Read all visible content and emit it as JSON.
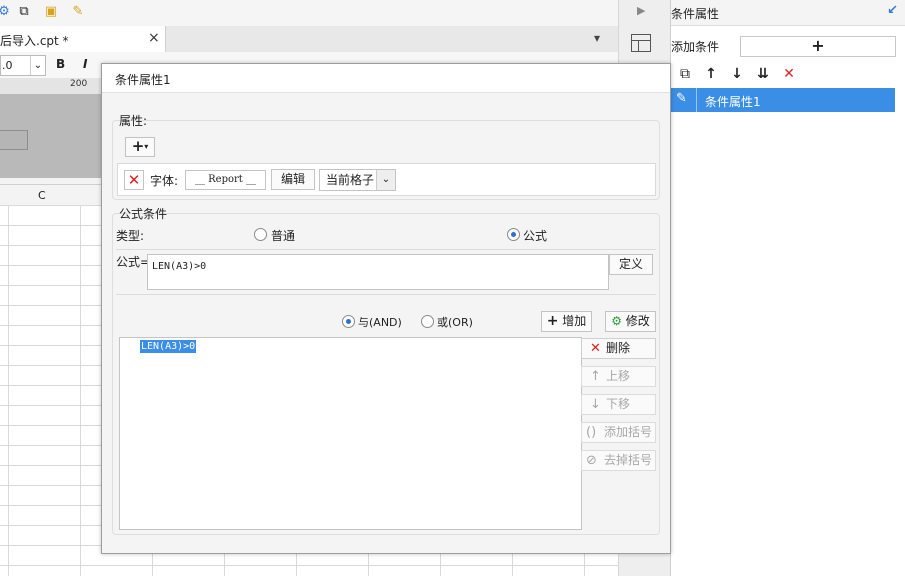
{
  "toolbar": {
    "icons": [
      "settings-icon",
      "copy-icon",
      "paste-icon",
      "brush-icon"
    ]
  },
  "tabs": {
    "doc_tab_label": "后导入.cpt *",
    "close_glyph": "×",
    "menu_glyph": "▾"
  },
  "format_bar": {
    "font_size": ".0",
    "bold": "B",
    "italic": "I"
  },
  "ruler": {
    "mark": "200"
  },
  "sheet": {
    "column_c": "C"
  },
  "right_panel": {
    "title": "条件属性",
    "add_condition_label": "添加条件",
    "add_button_glyph": "+",
    "list_items": [
      "条件属性1"
    ]
  },
  "dialog": {
    "title": "条件属性1",
    "attributes_label": "属性:",
    "attr_row": {
      "font_label": "字体:",
      "font_preview": "Report",
      "edit_button": "编辑",
      "scope_select": "当前格子"
    },
    "formula_group": {
      "title": "公式条件",
      "type_label": "类型:",
      "radio_normal": "普通",
      "radio_formula": "公式",
      "formula_label": "公式=",
      "formula_value": "LEN(A3)>0",
      "define_button": "定义"
    },
    "logic": {
      "and_label": "与(AND)",
      "or_label": "或(OR)",
      "add_button": "增加",
      "modify_button": "修改"
    },
    "conditions": [
      "LEN(A3)>0"
    ],
    "side_buttons": {
      "delete": "删除",
      "move_up": "上移",
      "move_down": "下移",
      "add_bracket": "添加括号",
      "remove_bracket": "去掉括号"
    }
  }
}
